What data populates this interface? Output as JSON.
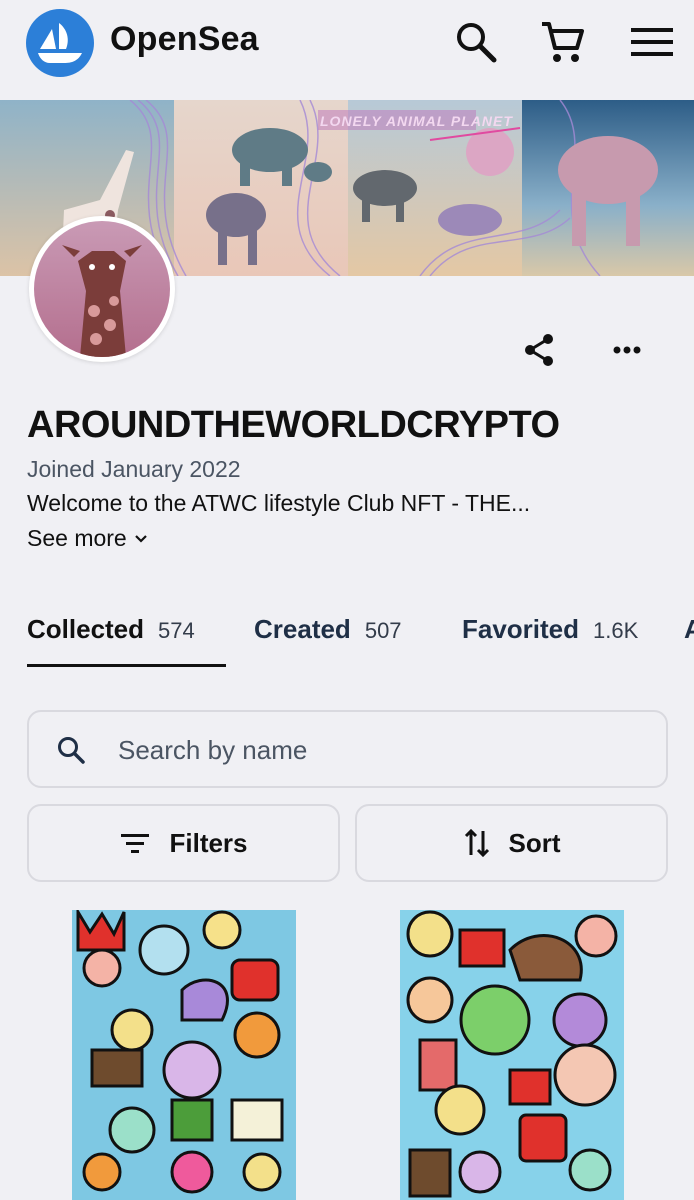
{
  "header": {
    "brand": "OpenSea",
    "icons": [
      "opensea-logo-icon",
      "search-icon",
      "cart-icon",
      "menu-icon"
    ]
  },
  "banner": {
    "text": "LONELY ANIMAL PLANET"
  },
  "profile": {
    "name": "AROUNDTHEWORLDCRYPTO",
    "joined": "Joined January 2022",
    "description": "Welcome to the ATWC lifestyle Club NFT - THE...",
    "see_more": "See more"
  },
  "tabs": [
    {
      "label": "Collected",
      "count": "574",
      "active": true
    },
    {
      "label": "Created",
      "count": "507",
      "active": false
    },
    {
      "label": "Favorited",
      "count": "1.6K",
      "active": false
    },
    {
      "label": "A",
      "count": "",
      "active": false
    }
  ],
  "search": {
    "placeholder": "Search by name"
  },
  "controls": {
    "filters": "Filters",
    "sort": "Sort"
  },
  "colors": {
    "brand_blue": "#2c7fd8",
    "background": "#f0f0f4",
    "border": "#d9d9df",
    "text_dark": "#111111",
    "text_muted": "#4b5563"
  }
}
